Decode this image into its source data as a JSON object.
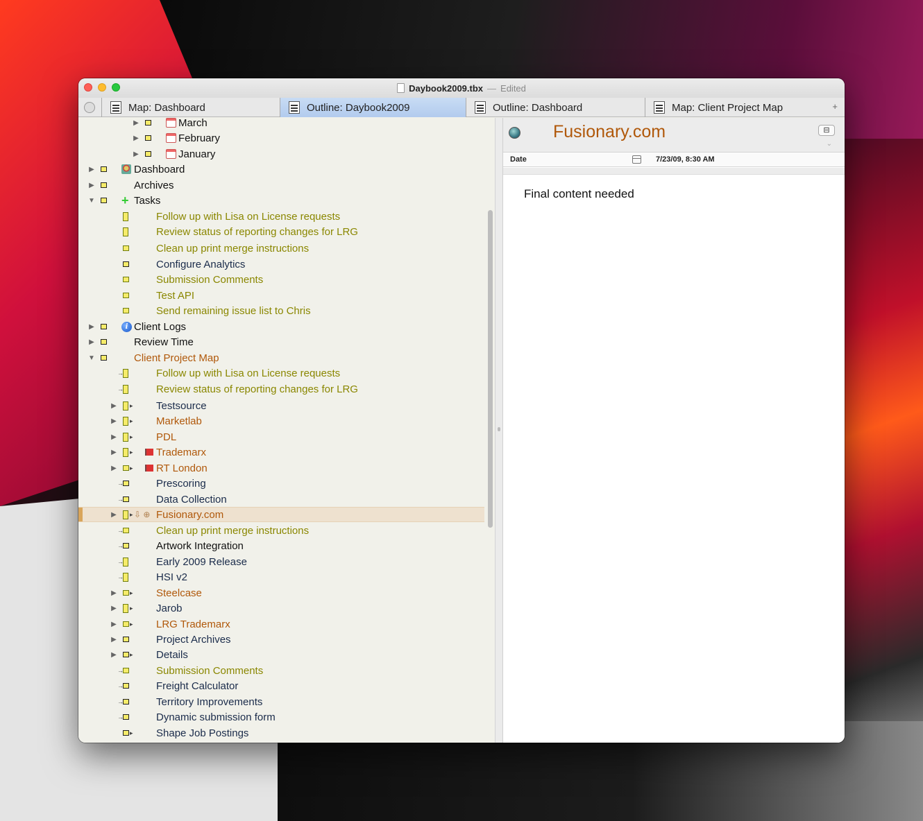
{
  "window": {
    "title": "Daybook2009.tbx",
    "status": "Edited"
  },
  "tabs": [
    {
      "label": "Map: Dashboard",
      "icon": "map-icon"
    },
    {
      "label": "Outline: Daybook2009",
      "icon": "outline-icon",
      "active": true
    },
    {
      "label": "Outline: Dashboard",
      "icon": "outline-icon"
    },
    {
      "label": "Map: Client Project Map",
      "icon": "map-icon"
    }
  ],
  "outline": {
    "rows": [
      {
        "label": "March",
        "color": "black",
        "icon": "calendar-icon"
      },
      {
        "label": "February",
        "color": "black",
        "icon": "calendar-icon"
      },
      {
        "label": "January",
        "color": "black",
        "icon": "calendar-icon"
      },
      {
        "label": "Dashboard",
        "color": "black",
        "icon": "dashboard-icon"
      },
      {
        "label": "Archives",
        "color": "black"
      },
      {
        "label": "Tasks",
        "color": "black",
        "icon": "plus-icon"
      },
      {
        "label": "Follow up with Lisa on License requests",
        "color": "olive"
      },
      {
        "label": "Review status of reporting changes for LRG",
        "color": "olive"
      },
      {
        "label": "Clean up print merge instructions",
        "color": "olive"
      },
      {
        "label": "Configure Analytics",
        "color": "navy"
      },
      {
        "label": "Submission Comments",
        "color": "olive"
      },
      {
        "label": "Test API",
        "color": "olive"
      },
      {
        "label": "Send remaining issue list to Chris",
        "color": "olive"
      },
      {
        "label": "Client Logs",
        "color": "black",
        "icon": "info-icon"
      },
      {
        "label": "Review Time",
        "color": "black"
      },
      {
        "label": "Client Project Map",
        "color": "orange"
      },
      {
        "label": "Follow up with Lisa on License requests",
        "color": "olive"
      },
      {
        "label": "Review status of reporting changes for LRG",
        "color": "olive"
      },
      {
        "label": "Testsource",
        "color": "navy"
      },
      {
        "label": "Marketlab",
        "color": "orange"
      },
      {
        "label": "PDL",
        "color": "orange"
      },
      {
        "label": "Trademarx",
        "color": "orange",
        "icon": "flag-icon"
      },
      {
        "label": "RT London",
        "color": "orange",
        "icon": "flag-icon"
      },
      {
        "label": "Prescoring",
        "color": "navy"
      },
      {
        "label": "Data Collection",
        "color": "navy"
      },
      {
        "label": "Fusionary.com",
        "color": "orange",
        "selected": true
      },
      {
        "label": "Clean up print merge instructions",
        "color": "olive"
      },
      {
        "label": "Artwork Integration",
        "color": "black"
      },
      {
        "label": "Early 2009 Release",
        "color": "navy"
      },
      {
        "label": "HSI v2",
        "color": "navy"
      },
      {
        "label": "Steelcase",
        "color": "orange"
      },
      {
        "label": "Jarob",
        "color": "navy"
      },
      {
        "label": "LRG Trademarx",
        "color": "orange"
      },
      {
        "label": "Project Archives",
        "color": "navy"
      },
      {
        "label": "Details",
        "color": "navy"
      },
      {
        "label": "Submission Comments",
        "color": "olive"
      },
      {
        "label": "Freight Calculator",
        "color": "navy"
      },
      {
        "label": "Territory Improvements",
        "color": "navy"
      },
      {
        "label": "Dynamic submission form",
        "color": "navy"
      },
      {
        "label": "Shape Job Postings",
        "color": "navy"
      }
    ]
  },
  "detail": {
    "title": "Fusionary.com",
    "attributes": [
      {
        "name": "Date",
        "value": "7/23/09, 8:30 AM",
        "icon": "calendar-icon"
      }
    ],
    "text": "Final content needed"
  }
}
